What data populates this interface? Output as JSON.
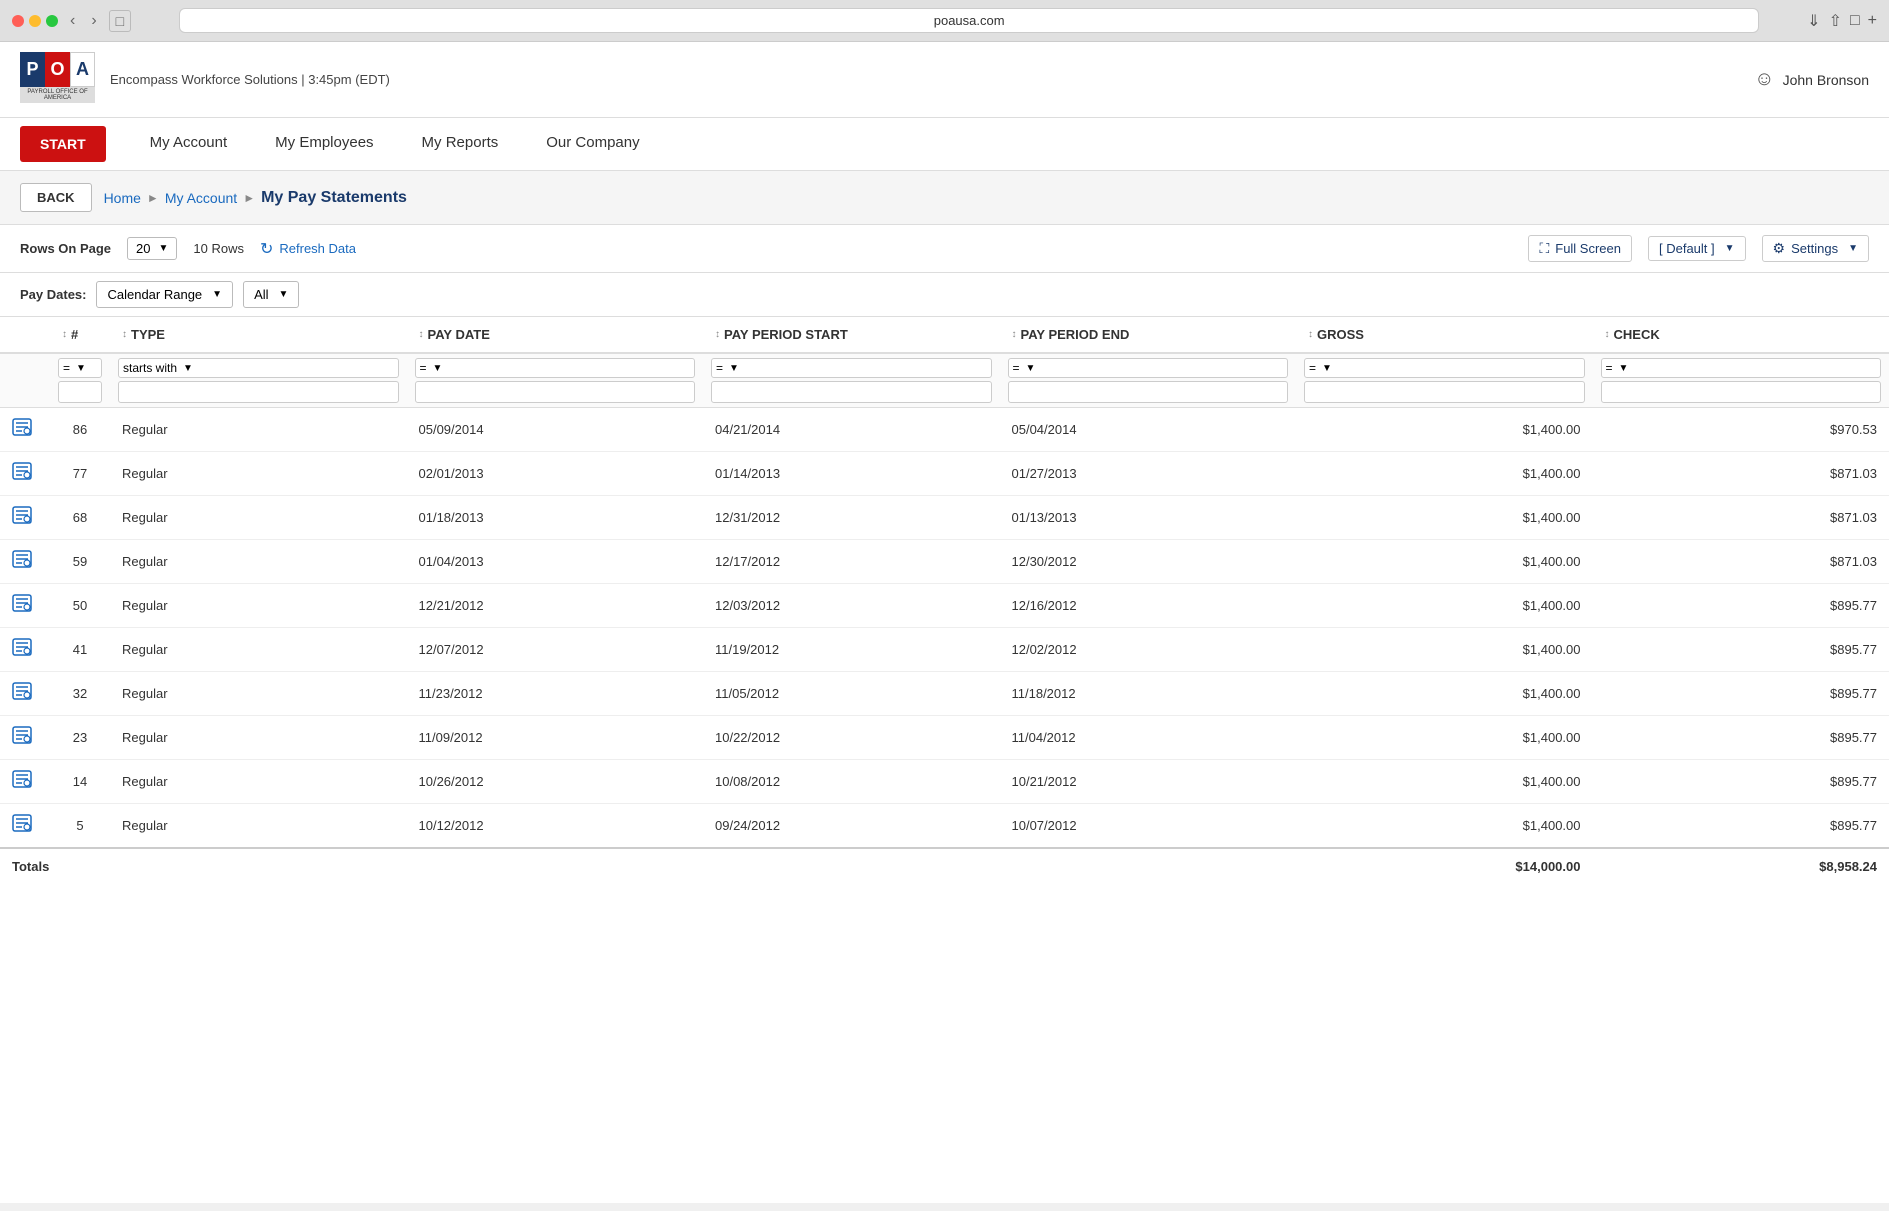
{
  "browser": {
    "url": "poausa.com",
    "window_btn": "⊡"
  },
  "header": {
    "company": "Encompass Workforce Solutions | 3:45pm (EDT)",
    "user": "John Bronson"
  },
  "nav": {
    "start_label": "START",
    "items": [
      {
        "id": "my-account",
        "label": "My Account"
      },
      {
        "id": "my-employees",
        "label": "My Employees"
      },
      {
        "id": "my-reports",
        "label": "My Reports"
      },
      {
        "id": "our-company",
        "label": "Our Company"
      }
    ]
  },
  "breadcrumb": {
    "back_label": "BACK",
    "home_label": "Home",
    "parent_label": "My Account",
    "current_label": "My Pay Statements"
  },
  "toolbar": {
    "rows_on_page_label": "Rows On Page",
    "rows_value": "20",
    "rows_count_label": "10  Rows",
    "refresh_label": "Refresh Data",
    "fullscreen_label": "Full Screen",
    "default_label": "[ Default ]",
    "settings_label": "Settings"
  },
  "filter": {
    "pay_dates_label": "Pay Dates:",
    "calendar_range_label": "Calendar Range",
    "all_label": "All"
  },
  "table": {
    "columns": [
      {
        "id": "icon",
        "label": ""
      },
      {
        "id": "num",
        "label": "#"
      },
      {
        "id": "type",
        "label": "TYPE"
      },
      {
        "id": "pay_date",
        "label": "PAY DATE"
      },
      {
        "id": "pay_period_start",
        "label": "PAY PERIOD START"
      },
      {
        "id": "pay_period_end",
        "label": "PAY PERIOD END"
      },
      {
        "id": "gross",
        "label": "GROSS"
      },
      {
        "id": "check",
        "label": "CHECK"
      }
    ],
    "filter_options": {
      "equals": "=",
      "starts_with": "starts with"
    },
    "rows": [
      {
        "num": "86",
        "type": "Regular",
        "pay_date": "05/09/2014",
        "pay_period_start": "04/21/2014",
        "pay_period_end": "05/04/2014",
        "gross": "$1,400.00",
        "check": "$970.53"
      },
      {
        "num": "77",
        "type": "Regular",
        "pay_date": "02/01/2013",
        "pay_period_start": "01/14/2013",
        "pay_period_end": "01/27/2013",
        "gross": "$1,400.00",
        "check": "$871.03"
      },
      {
        "num": "68",
        "type": "Regular",
        "pay_date": "01/18/2013",
        "pay_period_start": "12/31/2012",
        "pay_period_end": "01/13/2013",
        "gross": "$1,400.00",
        "check": "$871.03"
      },
      {
        "num": "59",
        "type": "Regular",
        "pay_date": "01/04/2013",
        "pay_period_start": "12/17/2012",
        "pay_period_end": "12/30/2012",
        "gross": "$1,400.00",
        "check": "$871.03"
      },
      {
        "num": "50",
        "type": "Regular",
        "pay_date": "12/21/2012",
        "pay_period_start": "12/03/2012",
        "pay_period_end": "12/16/2012",
        "gross": "$1,400.00",
        "check": "$895.77"
      },
      {
        "num": "41",
        "type": "Regular",
        "pay_date": "12/07/2012",
        "pay_period_start": "11/19/2012",
        "pay_period_end": "12/02/2012",
        "gross": "$1,400.00",
        "check": "$895.77"
      },
      {
        "num": "32",
        "type": "Regular",
        "pay_date": "11/23/2012",
        "pay_period_start": "11/05/2012",
        "pay_period_end": "11/18/2012",
        "gross": "$1,400.00",
        "check": "$895.77"
      },
      {
        "num": "23",
        "type": "Regular",
        "pay_date": "11/09/2012",
        "pay_period_start": "10/22/2012",
        "pay_period_end": "11/04/2012",
        "gross": "$1,400.00",
        "check": "$895.77"
      },
      {
        "num": "14",
        "type": "Regular",
        "pay_date": "10/26/2012",
        "pay_period_start": "10/08/2012",
        "pay_period_end": "10/21/2012",
        "gross": "$1,400.00",
        "check": "$895.77"
      },
      {
        "num": "5",
        "type": "Regular",
        "pay_date": "10/12/2012",
        "pay_period_start": "09/24/2012",
        "pay_period_end": "10/07/2012",
        "gross": "$1,400.00",
        "check": "$895.77"
      }
    ],
    "totals": {
      "label": "Totals",
      "gross": "$14,000.00",
      "check": "$8,958.24"
    }
  }
}
